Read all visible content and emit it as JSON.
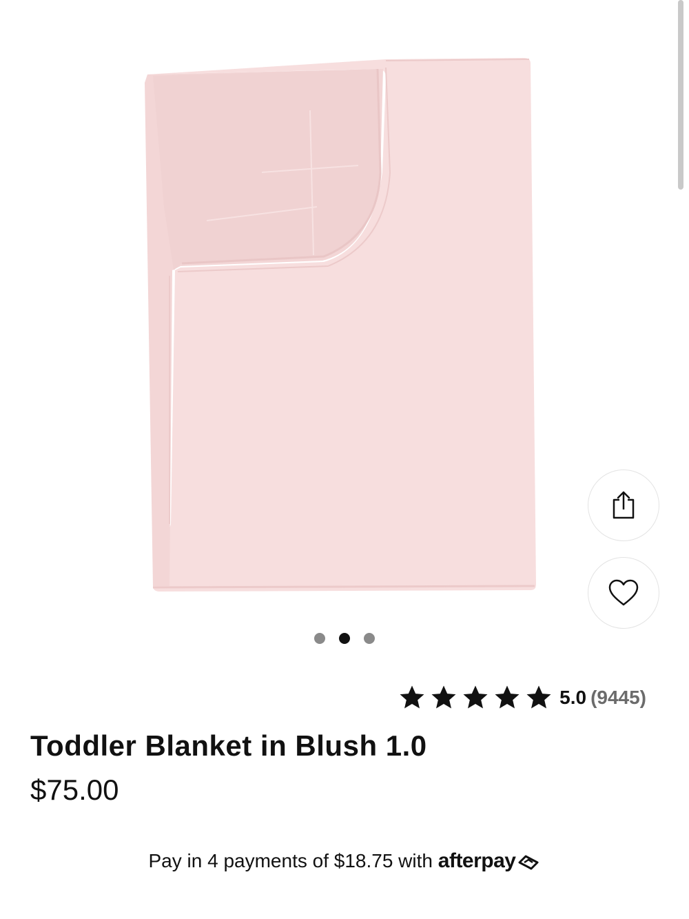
{
  "product": {
    "title": "Toddler Blanket in Blush 1.0",
    "price": "$75.00",
    "image_color": "#f7dede"
  },
  "gallery": {
    "dots": 3,
    "active_index": 1
  },
  "actions": {
    "share_icon": "share-icon",
    "favorite_icon": "heart-icon"
  },
  "rating": {
    "value": "5.0",
    "count": "(9445)",
    "stars": 5
  },
  "afterpay": {
    "prefix": "Pay in 4 payments of ",
    "amount": "$18.75",
    "with": " with ",
    "brand": "afterpay"
  }
}
